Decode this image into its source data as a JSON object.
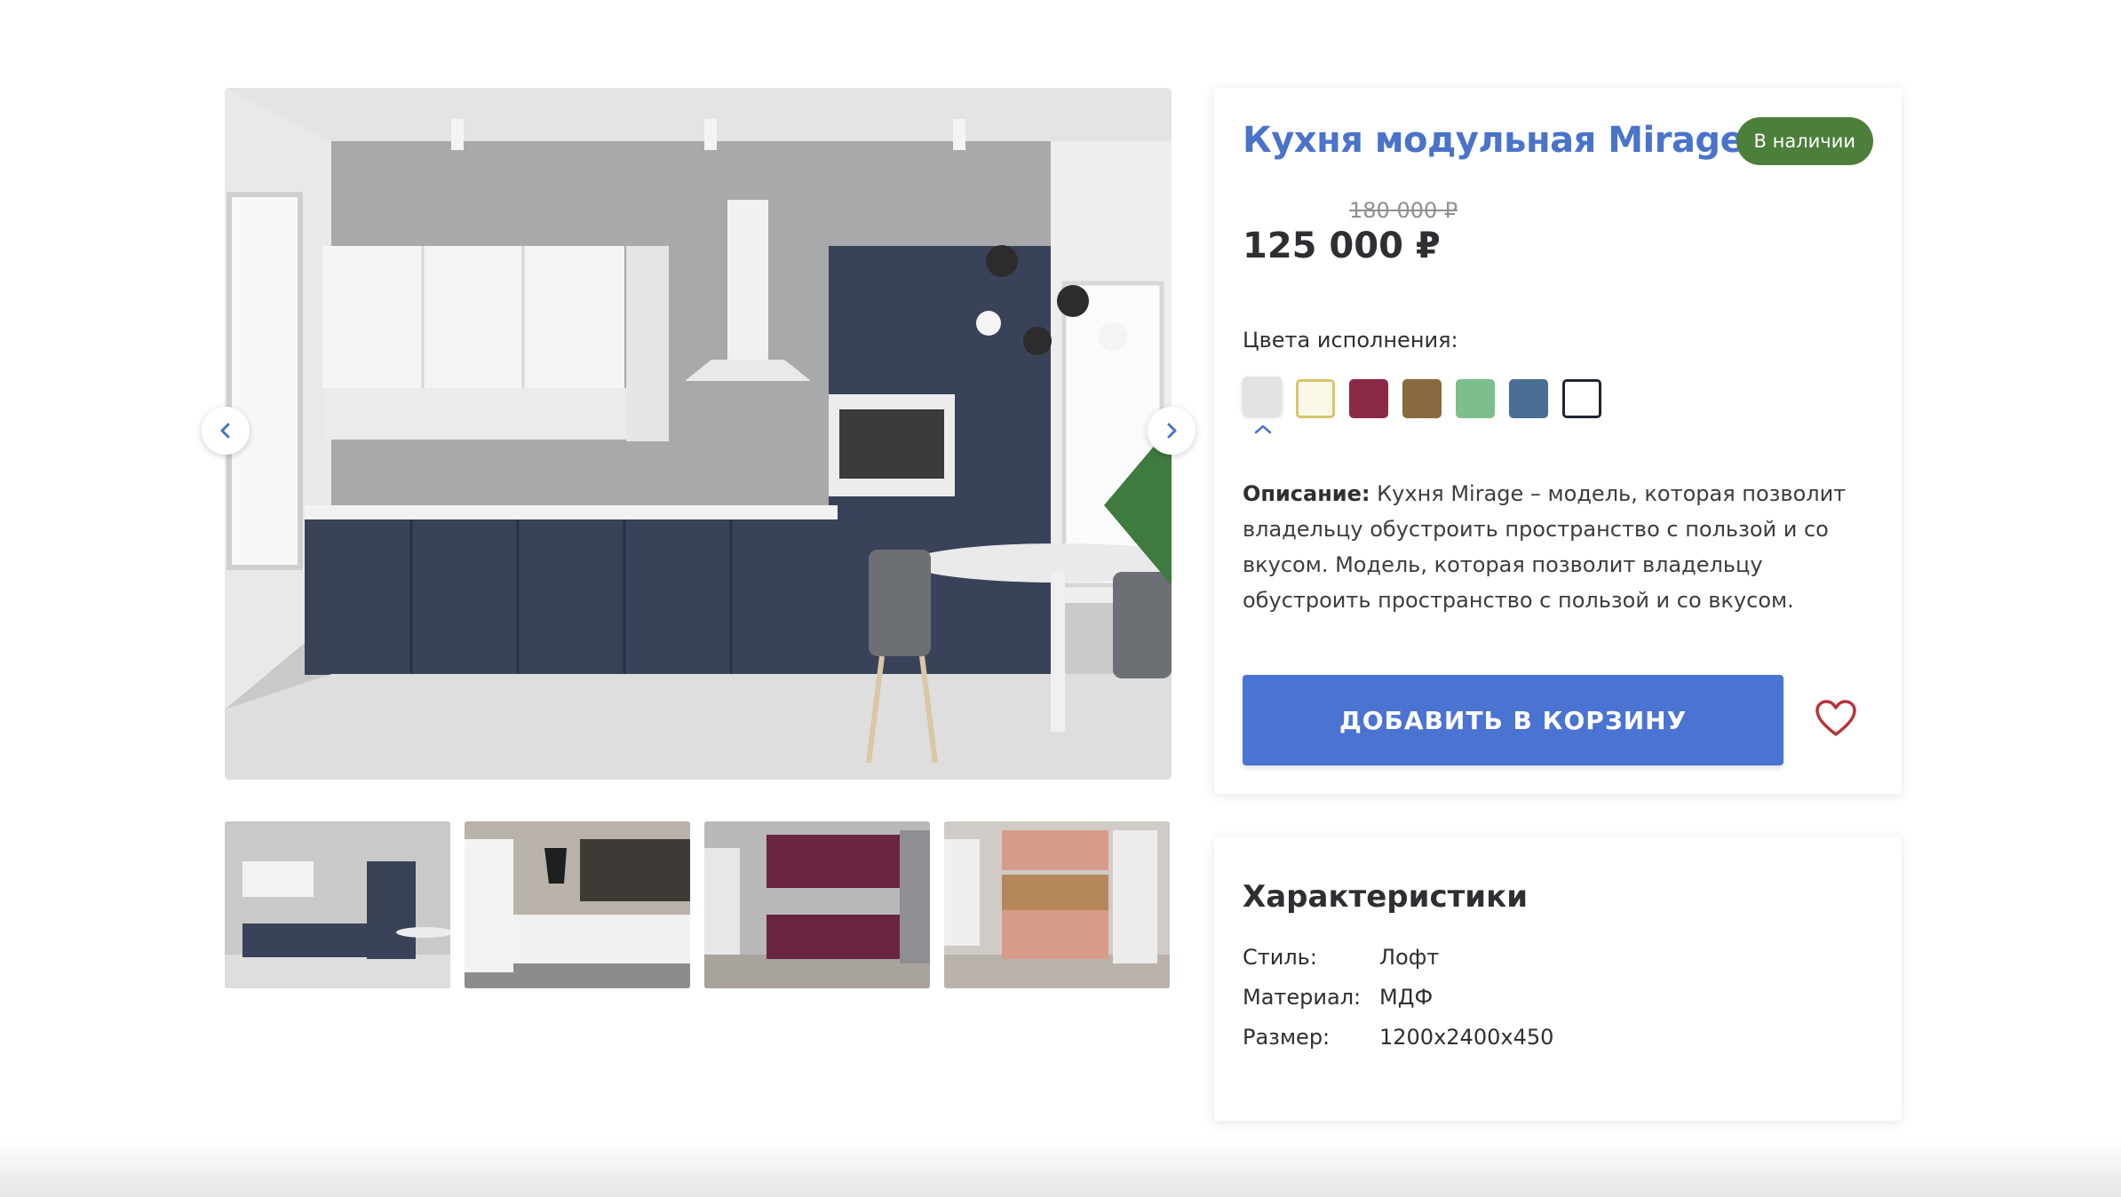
{
  "product": {
    "title": "Кухня модульная Mirage",
    "stock_badge": "В наличии",
    "old_price": "180 000 ₽",
    "price": "125 000 ₽",
    "colors_label": "Цвета исполнения:",
    "colors": [
      {
        "hex": "#e3e3e3",
        "border": "#e3e3e3",
        "selected": true
      },
      {
        "hex": "#fbf8e8",
        "border": "#d8c56c",
        "selected": false
      },
      {
        "hex": "#8b2a45",
        "border": "#8b2a45",
        "selected": false
      },
      {
        "hex": "#8a6a3e",
        "border": "#8a6a3e",
        "selected": false
      },
      {
        "hex": "#7cbf8c",
        "border": "#7cbf8c",
        "selected": false
      },
      {
        "hex": "#4a6f95",
        "border": "#4a6f95",
        "selected": false
      },
      {
        "hex": "#ffffff",
        "border": "#1d2333",
        "selected": false
      }
    ],
    "description_label": "Описание:",
    "description_text": " Кухня Mirage – модель, которая позволит владельцу обустроить пространство с пользой и со вкусом. Модель, которая позволит владельцу обустроить пространство с пользой и со вкусом.",
    "add_to_cart": "ДОБАВИТЬ В КОРЗИНУ"
  },
  "specs": {
    "title": "Характеристики",
    "rows": [
      {
        "key": "Стиль:",
        "value": "Лофт"
      },
      {
        "key": "Материал:",
        "value": "МДФ"
      },
      {
        "key": "Размер:",
        "value": "1200x2400x450"
      }
    ]
  },
  "icons": {
    "prev": "chevron-left-icon",
    "next": "chevron-right-icon",
    "wishlist": "heart-icon",
    "selected_color": "chevron-up-icon"
  },
  "accent_colors": {
    "title": "#4a73c9",
    "button": "#4a73d2",
    "badge": "#4b7f3a",
    "heart": "#b8323a"
  }
}
